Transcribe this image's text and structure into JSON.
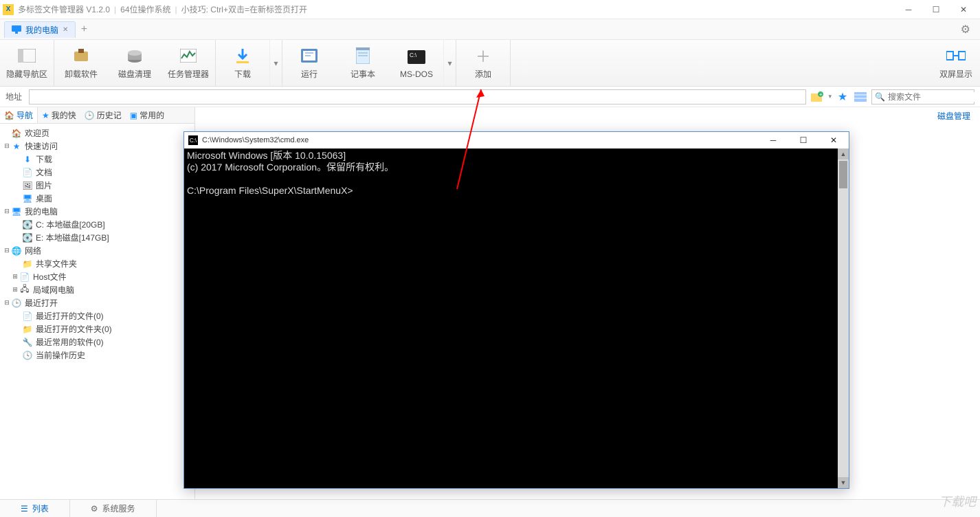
{
  "titlebar": {
    "app_name": "多标签文件管理器 V1.2.0",
    "os_bits": "64位操作系统",
    "tip": "小技巧: Ctrl+双击=在新标签页打开"
  },
  "tabs": {
    "active": "我的电脑"
  },
  "toolbar": {
    "hide_nav": "隐藏导航区",
    "uninstall": "卸载软件",
    "disk_clean": "磁盘清理",
    "task_mgr": "任务管理器",
    "download": "下载",
    "run": "运行",
    "notepad": "记事本",
    "msdos": "MS-DOS",
    "add": "添加",
    "dual": "双屏显示"
  },
  "address": {
    "label": "地址",
    "value": ""
  },
  "search": {
    "placeholder": "搜索文件"
  },
  "side_tabs": {
    "nav": "导航",
    "fav": "我的快",
    "history": "历史记",
    "common": "常用的"
  },
  "tree": {
    "welcome": "欢迎页",
    "quick": "快速访问",
    "download": "下载",
    "docs": "文档",
    "pics": "图片",
    "desktop": "桌面",
    "mypc": "我的电脑",
    "c_drive": "C: 本地磁盘[20GB]",
    "e_drive": "E: 本地磁盘[147GB]",
    "network": "网络",
    "share": "共享文件夹",
    "hosts": "Host文件",
    "lan": "局域网电脑",
    "recent": "最近打开",
    "recent_files": "最近打开的文件(0)",
    "recent_folders": "最近打开的文件夹(0)",
    "recent_sw": "最近常用的软件(0)",
    "history": "当前操作历史"
  },
  "main": {
    "disk_mgr": "磁盘管理"
  },
  "bottom": {
    "list": "列表",
    "services": "系统服务"
  },
  "cmd": {
    "title": "C:\\Windows\\System32\\cmd.exe",
    "line1": "Microsoft Windows [版本 10.0.15063]",
    "line2": "(c) 2017 Microsoft Corporation。保留所有权利。",
    "prompt": "C:\\Program Files\\SuperX\\StartMenuX>"
  },
  "watermark": "下载吧"
}
